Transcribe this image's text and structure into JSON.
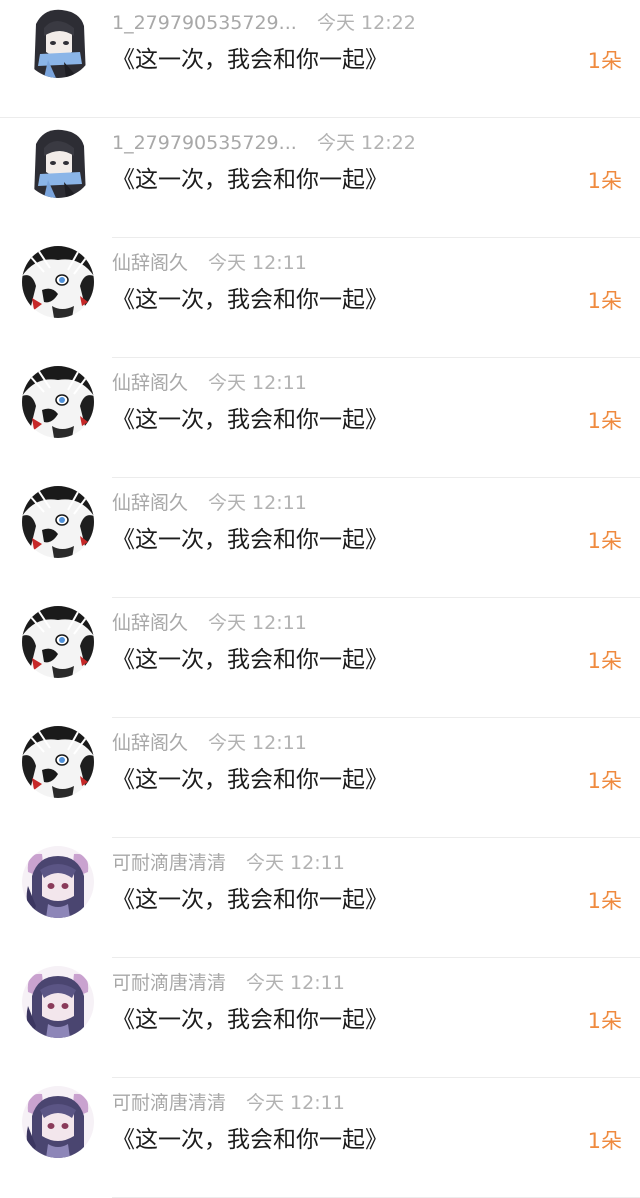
{
  "comments": [
    {
      "user": "1_279790535729...",
      "time": "今天 12:22",
      "message": "《这一次，我会和你一起》",
      "gift": "1朵",
      "avatar": "anime-girl-dark-hair-scarf"
    },
    {
      "user": "1_279790535729...",
      "time": "今天 12:22",
      "message": "《这一次，我会和你一起》",
      "gift": "1朵",
      "avatar": "anime-girl-dark-hair-scarf"
    },
    {
      "user": "仙辞阁久",
      "time": "今天 12:11",
      "message": "《这一次，我会和你一起》",
      "gift": "1朵",
      "avatar": "anime-character-black-white-red"
    },
    {
      "user": "仙辞阁久",
      "time": "今天 12:11",
      "message": "《这一次，我会和你一起》",
      "gift": "1朵",
      "avatar": "anime-character-black-white-red"
    },
    {
      "user": "仙辞阁久",
      "time": "今天 12:11",
      "message": "《这一次，我会和你一起》",
      "gift": "1朵",
      "avatar": "anime-character-black-white-red"
    },
    {
      "user": "仙辞阁久",
      "time": "今天 12:11",
      "message": "《这一次，我会和你一起》",
      "gift": "1朵",
      "avatar": "anime-character-black-white-red"
    },
    {
      "user": "仙辞阁久",
      "time": "今天 12:11",
      "message": "《这一次，我会和你一起》",
      "gift": "1朵",
      "avatar": "anime-character-black-white-red"
    },
    {
      "user": "可耐滴唐清清",
      "time": "今天 12:11",
      "message": "《这一次，我会和你一起》",
      "gift": "1朵",
      "avatar": "anime-girl-purple-pink-hair"
    },
    {
      "user": "可耐滴唐清清",
      "time": "今天 12:11",
      "message": "《这一次，我会和你一起》",
      "gift": "1朵",
      "avatar": "anime-girl-purple-pink-hair"
    },
    {
      "user": "可耐滴唐清清",
      "time": "今天 12:11",
      "message": "《这一次，我会和你一起》",
      "gift": "1朵",
      "avatar": "anime-girl-purple-pink-hair"
    }
  ],
  "colors": {
    "username": "#a8a8a8",
    "time": "#b2b2b2",
    "message": "#1c1c1c",
    "gift": "#ef8a3e",
    "divider": "#ececec"
  }
}
